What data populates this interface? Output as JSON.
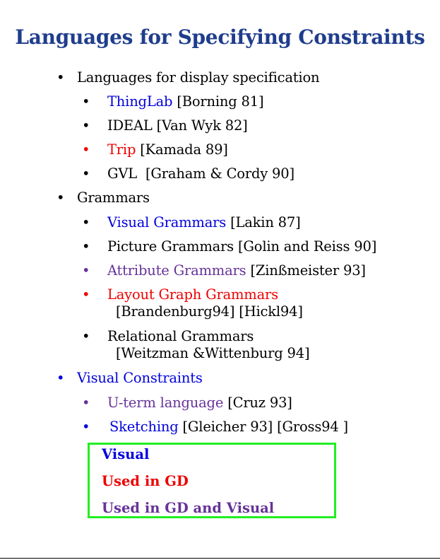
{
  "title": "Languages for Specifying Constraints",
  "bullet": "•",
  "sections": [
    {
      "label": "Languages for display specification",
      "items": [
        {
          "name": "ThingLab",
          "ref": "[Borning 81]"
        },
        {
          "name": "IDEAL",
          "ref": "[Van Wyk 82]"
        },
        {
          "name": "Trip",
          "ref": "[Kamada 89]"
        },
        {
          "name": "GVL",
          "ref": "[Graham & Cordy 90]"
        }
      ]
    },
    {
      "label": "Grammars",
      "items": [
        {
          "name": "Visual Grammars",
          "ref": "[Lakin 87]"
        },
        {
          "name": "Picture Grammars",
          "ref": "[Golin and Reiss 90]"
        },
        {
          "name": "Attribute Grammars",
          "ref": "[Zinßmeister 93]"
        },
        {
          "name": "Layout Graph Grammars",
          "ref": "[Brandenburg94] [Hickl94]"
        },
        {
          "name": "Relational Grammars",
          "ref": "[Weitzman &Wittenburg 94]"
        }
      ]
    },
    {
      "label": "Visual Constraints",
      "items": [
        {
          "name": "U-term language",
          "ref": "[Cruz 93]"
        },
        {
          "name": "Sketching",
          "ref": "[Gleicher 93] [Gross94 ]"
        }
      ]
    }
  ],
  "legend": {
    "visual": "Visual",
    "used_in_gd": "Used in GD",
    "used_in_gd_and_visual": "Used in GD and Visual"
  },
  "colors": {
    "title": "#1f3d8c",
    "visual": "#0000dd",
    "used_in_gd": "#ee0000",
    "used_in_gd_and_visual": "#663399",
    "legend_border": "#22ee22",
    "text": "#000000"
  }
}
